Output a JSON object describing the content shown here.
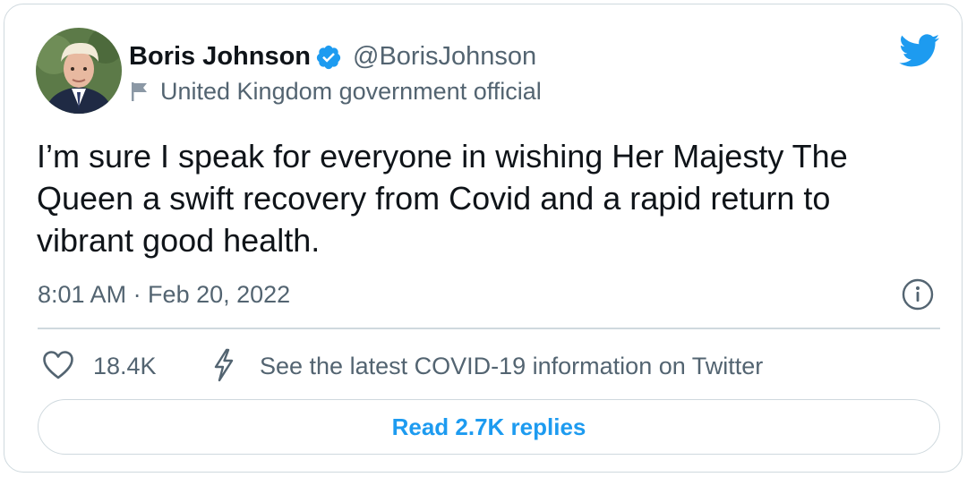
{
  "author": {
    "name": "Boris Johnson",
    "handle": "@BorisJohnson",
    "verified": true,
    "affiliation_label": "United Kingdom government official",
    "avatar_icon": "avatar-photo"
  },
  "tweet": {
    "text": "I’m sure I speak for everyone in wishing Her Majesty The Queen a swift recovery from Covid and a rapid return to vibrant good health.",
    "timestamp": "8:01 AM · Feb 20, 2022"
  },
  "actions": {
    "likes_count": "18.4K",
    "covid_notice": "See the latest COVID-19 information on Twitter",
    "replies_button": "Read 2.7K replies"
  },
  "icons": {
    "verified": "verified-badge-icon",
    "flag": "flag-icon",
    "brand": "twitter-bird-icon",
    "info": "info-icon",
    "like": "heart-icon",
    "covid": "lightning-icon"
  },
  "colors": {
    "accent": "#1d9bf0",
    "text_primary": "#0f1419",
    "text_secondary": "#536471",
    "border": "#cfd9de"
  }
}
